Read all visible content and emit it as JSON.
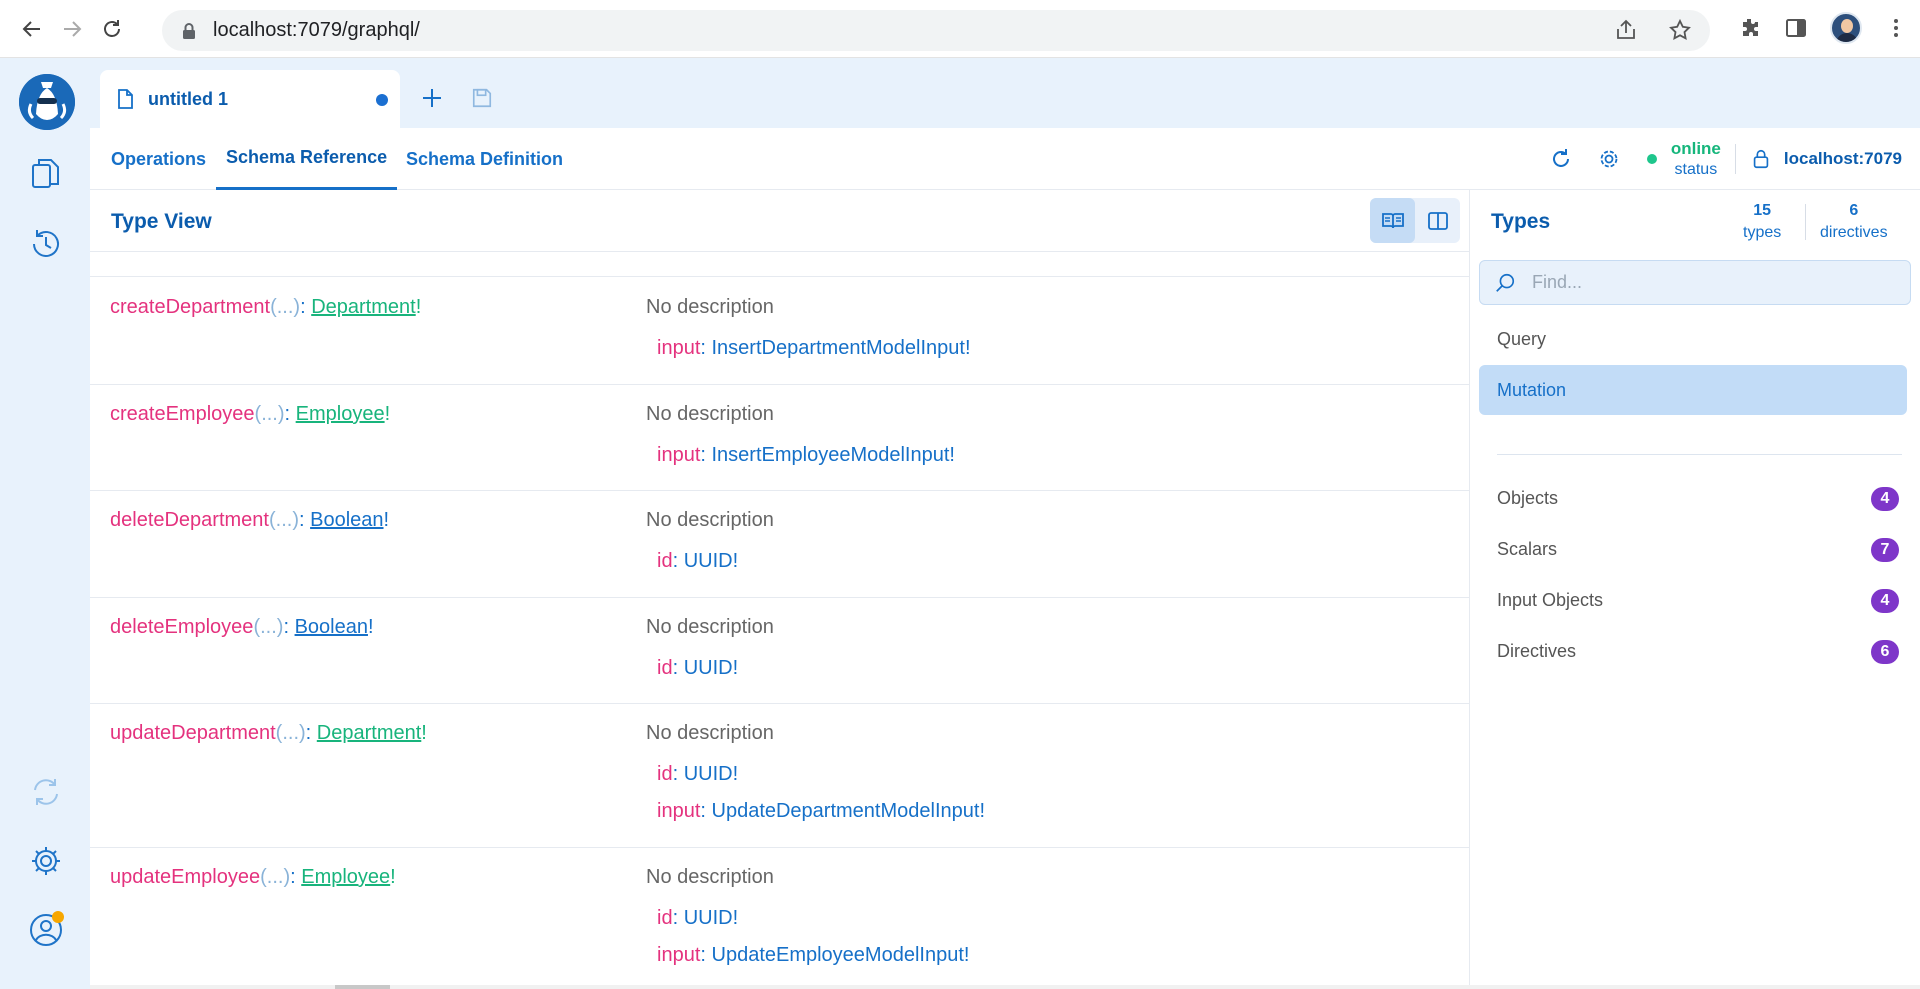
{
  "browser": {
    "url": "localhost:7079/graphql/"
  },
  "tab": {
    "title": "untitled 1"
  },
  "subnav": {
    "tabs": [
      "Operations",
      "Schema Reference",
      "Schema Definition"
    ],
    "active": "Schema Reference",
    "status_online": "online",
    "status_label": "status",
    "host": "localhost:7079"
  },
  "typeview": {
    "title": "Type View",
    "fields": [
      {
        "name": "createDepartment",
        "args_short": "(...)",
        "type": "Department",
        "scalar": false,
        "description": "No description",
        "args": [
          {
            "name": "input",
            "type": "InsertDepartmentModelInput!"
          }
        ]
      },
      {
        "name": "createEmployee",
        "args_short": "(...)",
        "type": "Employee",
        "scalar": false,
        "description": "No description",
        "args": [
          {
            "name": "input",
            "type": "InsertEmployeeModelInput!"
          }
        ]
      },
      {
        "name": "deleteDepartment",
        "args_short": "(...)",
        "type": "Boolean",
        "scalar": true,
        "description": "No description",
        "args": [
          {
            "name": "id",
            "type": "UUID!"
          }
        ]
      },
      {
        "name": "deleteEmployee",
        "args_short": "(...)",
        "type": "Boolean",
        "scalar": true,
        "description": "No description",
        "args": [
          {
            "name": "id",
            "type": "UUID!"
          }
        ]
      },
      {
        "name": "updateDepartment",
        "args_short": "(...)",
        "type": "Department",
        "scalar": false,
        "description": "No description",
        "args": [
          {
            "name": "id",
            "type": "UUID!"
          },
          {
            "name": "input",
            "type": "UpdateDepartmentModelInput!"
          }
        ]
      },
      {
        "name": "updateEmployee",
        "args_short": "(...)",
        "type": "Employee",
        "scalar": false,
        "description": "No description",
        "args": [
          {
            "name": "id",
            "type": "UUID!"
          },
          {
            "name": "input",
            "type": "UpdateEmployeeModelInput!"
          }
        ]
      }
    ]
  },
  "types_panel": {
    "title": "Types",
    "types_count": "15",
    "types_label": "types",
    "directives_count": "6",
    "directives_label": "directives",
    "search_placeholder": "Find...",
    "roots": [
      "Query",
      "Mutation"
    ],
    "active_root": "Mutation",
    "categories": [
      {
        "label": "Objects",
        "count": "4"
      },
      {
        "label": "Scalars",
        "count": "7"
      },
      {
        "label": "Input Objects",
        "count": "4"
      },
      {
        "label": "Directives",
        "count": "6"
      }
    ]
  },
  "colors": {
    "accent": "#1670c8",
    "field_name": "#e4327e",
    "object_type": "#18b47c",
    "badge": "#7e36c9",
    "online": "#16b67c"
  }
}
